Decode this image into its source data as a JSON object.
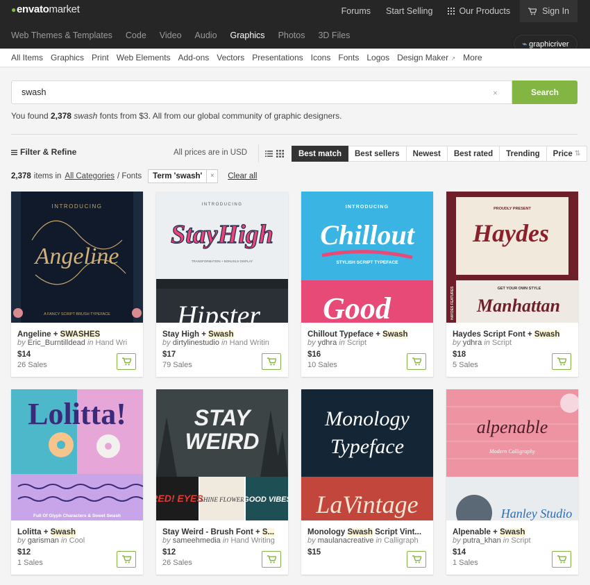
{
  "header": {
    "logo_brand": "envato",
    "logo_suffix": "market",
    "links": [
      "Forums",
      "Start Selling",
      "Our Products",
      "Sign In"
    ],
    "categories": [
      "Web Themes & Templates",
      "Code",
      "Video",
      "Audio",
      "Graphics",
      "Photos",
      "3D Files"
    ],
    "active_category": "Graphics",
    "site_badge": "graphicriver"
  },
  "subnav": [
    "All Items",
    "Graphics",
    "Print",
    "Web Elements",
    "Add-ons",
    "Vectors",
    "Presentations",
    "Icons",
    "Fonts",
    "Logos",
    "Design Maker",
    "More"
  ],
  "search": {
    "value": "swash",
    "button": "Search",
    "clear": "×"
  },
  "results": {
    "pre": "You found ",
    "count": "2,378",
    "term": "swash",
    "post": " fonts from $3. All from our global community of graphic designers."
  },
  "toolbar": {
    "filter_label": "Filter & Refine",
    "prices_note": "All prices are in USD",
    "sorts": [
      "Best match",
      "Best sellers",
      "Newest",
      "Best rated",
      "Trending",
      "Price"
    ],
    "active_sort": "Best match",
    "items_count": "2,378",
    "items_in": "items in",
    "all_categories": "All Categories",
    "crumb": "/ Fonts",
    "term_chip": "Term 'swash'",
    "chip_close": "×",
    "clear_all": "Clear all"
  },
  "items": [
    {
      "title_pre": "Angeline + ",
      "title_hl": "SWASHES",
      "title_post": "",
      "author": "Eric_Burntilldead",
      "category": "Hand Wri",
      "price": "$14",
      "sales": "26 Sales",
      "thumb_text": [
        "INTRODUCING",
        "Angeline",
        "A FANCY SCRIPT BRUSH TYPEFACE"
      ]
    },
    {
      "title_pre": "Stay High + ",
      "title_hl": "Swash",
      "title_post": "",
      "author": "dirtylinestudio",
      "category": "Hand Writin",
      "price": "$17",
      "sales": "79 Sales",
      "thumb_text": [
        "INTRODUCING",
        "StayHigh",
        "TRANSFORMATION + BONUSLS DISPLAY",
        "Hipster"
      ]
    },
    {
      "title_pre": "Chillout Typeface + ",
      "title_hl": "Swash",
      "title_post": "",
      "author": "ydhra",
      "category": "Script",
      "price": "$16",
      "sales": "10 Sales",
      "thumb_text": [
        "INTRODUCING",
        "Chillout",
        "STYLISH SCRIPT TYPEFACE",
        "Good"
      ]
    },
    {
      "title_pre": "Haydes Script Font + ",
      "title_hl": "Swash",
      "title_post": "",
      "author": "ydhra",
      "category": "Script",
      "price": "$18",
      "sales": "5 Sales",
      "thumb_text": [
        "PROUDLY PRESENT",
        "Haydes",
        "GET YOUR OWN STYLE",
        "Manhattan",
        "HAYDES FEATURES"
      ]
    },
    {
      "title_pre": "Lolitta + ",
      "title_hl": "Swash",
      "title_post": "",
      "author": "garisman",
      "category": "Cool",
      "price": "$12",
      "sales": "1 Sales",
      "thumb_text": [
        "Lolitta!",
        "Full Of Glyph Characters & Sweet Swash"
      ]
    },
    {
      "title_pre": "Stay Weird - Brush Font + ",
      "title_hl": "S...",
      "title_post": "",
      "author": "sameehmedia",
      "category": "Hand Writing",
      "price": "$12",
      "sales": "26 Sales",
      "thumb_text": [
        "STAY",
        "WEIRD",
        "RED! EYES",
        "SHINE FLOWER",
        "GOOD VIBES"
      ]
    },
    {
      "title_pre": "Monology ",
      "title_hl": "Swash",
      "title_post": " Script Vint...",
      "author": "maulanacreative",
      "category": "Calligraph",
      "price": "$15",
      "sales": "",
      "thumb_text": [
        "Monology",
        "Typeface",
        "LaVintage"
      ]
    },
    {
      "title_pre": "Alpenable + ",
      "title_hl": "Swash",
      "title_post": "",
      "author": "putra_khan",
      "category": "Script",
      "price": "$14",
      "sales": "1 Sales",
      "thumb_text": [
        "alpenable",
        "Modern Calligraphy",
        "Hanley Studio"
      ]
    }
  ],
  "labels": {
    "by": "by",
    "in": "in"
  },
  "colors": {
    "accent": "#82b541",
    "topbar": "#262626",
    "highlight": "#fdf7d8"
  },
  "icons": {
    "cart": "cart-icon",
    "grid": "grid-icon",
    "filter": "filter-icon",
    "list_view": "list-view-icon",
    "grid_view": "grid-view-icon",
    "external": "external-link-icon"
  }
}
